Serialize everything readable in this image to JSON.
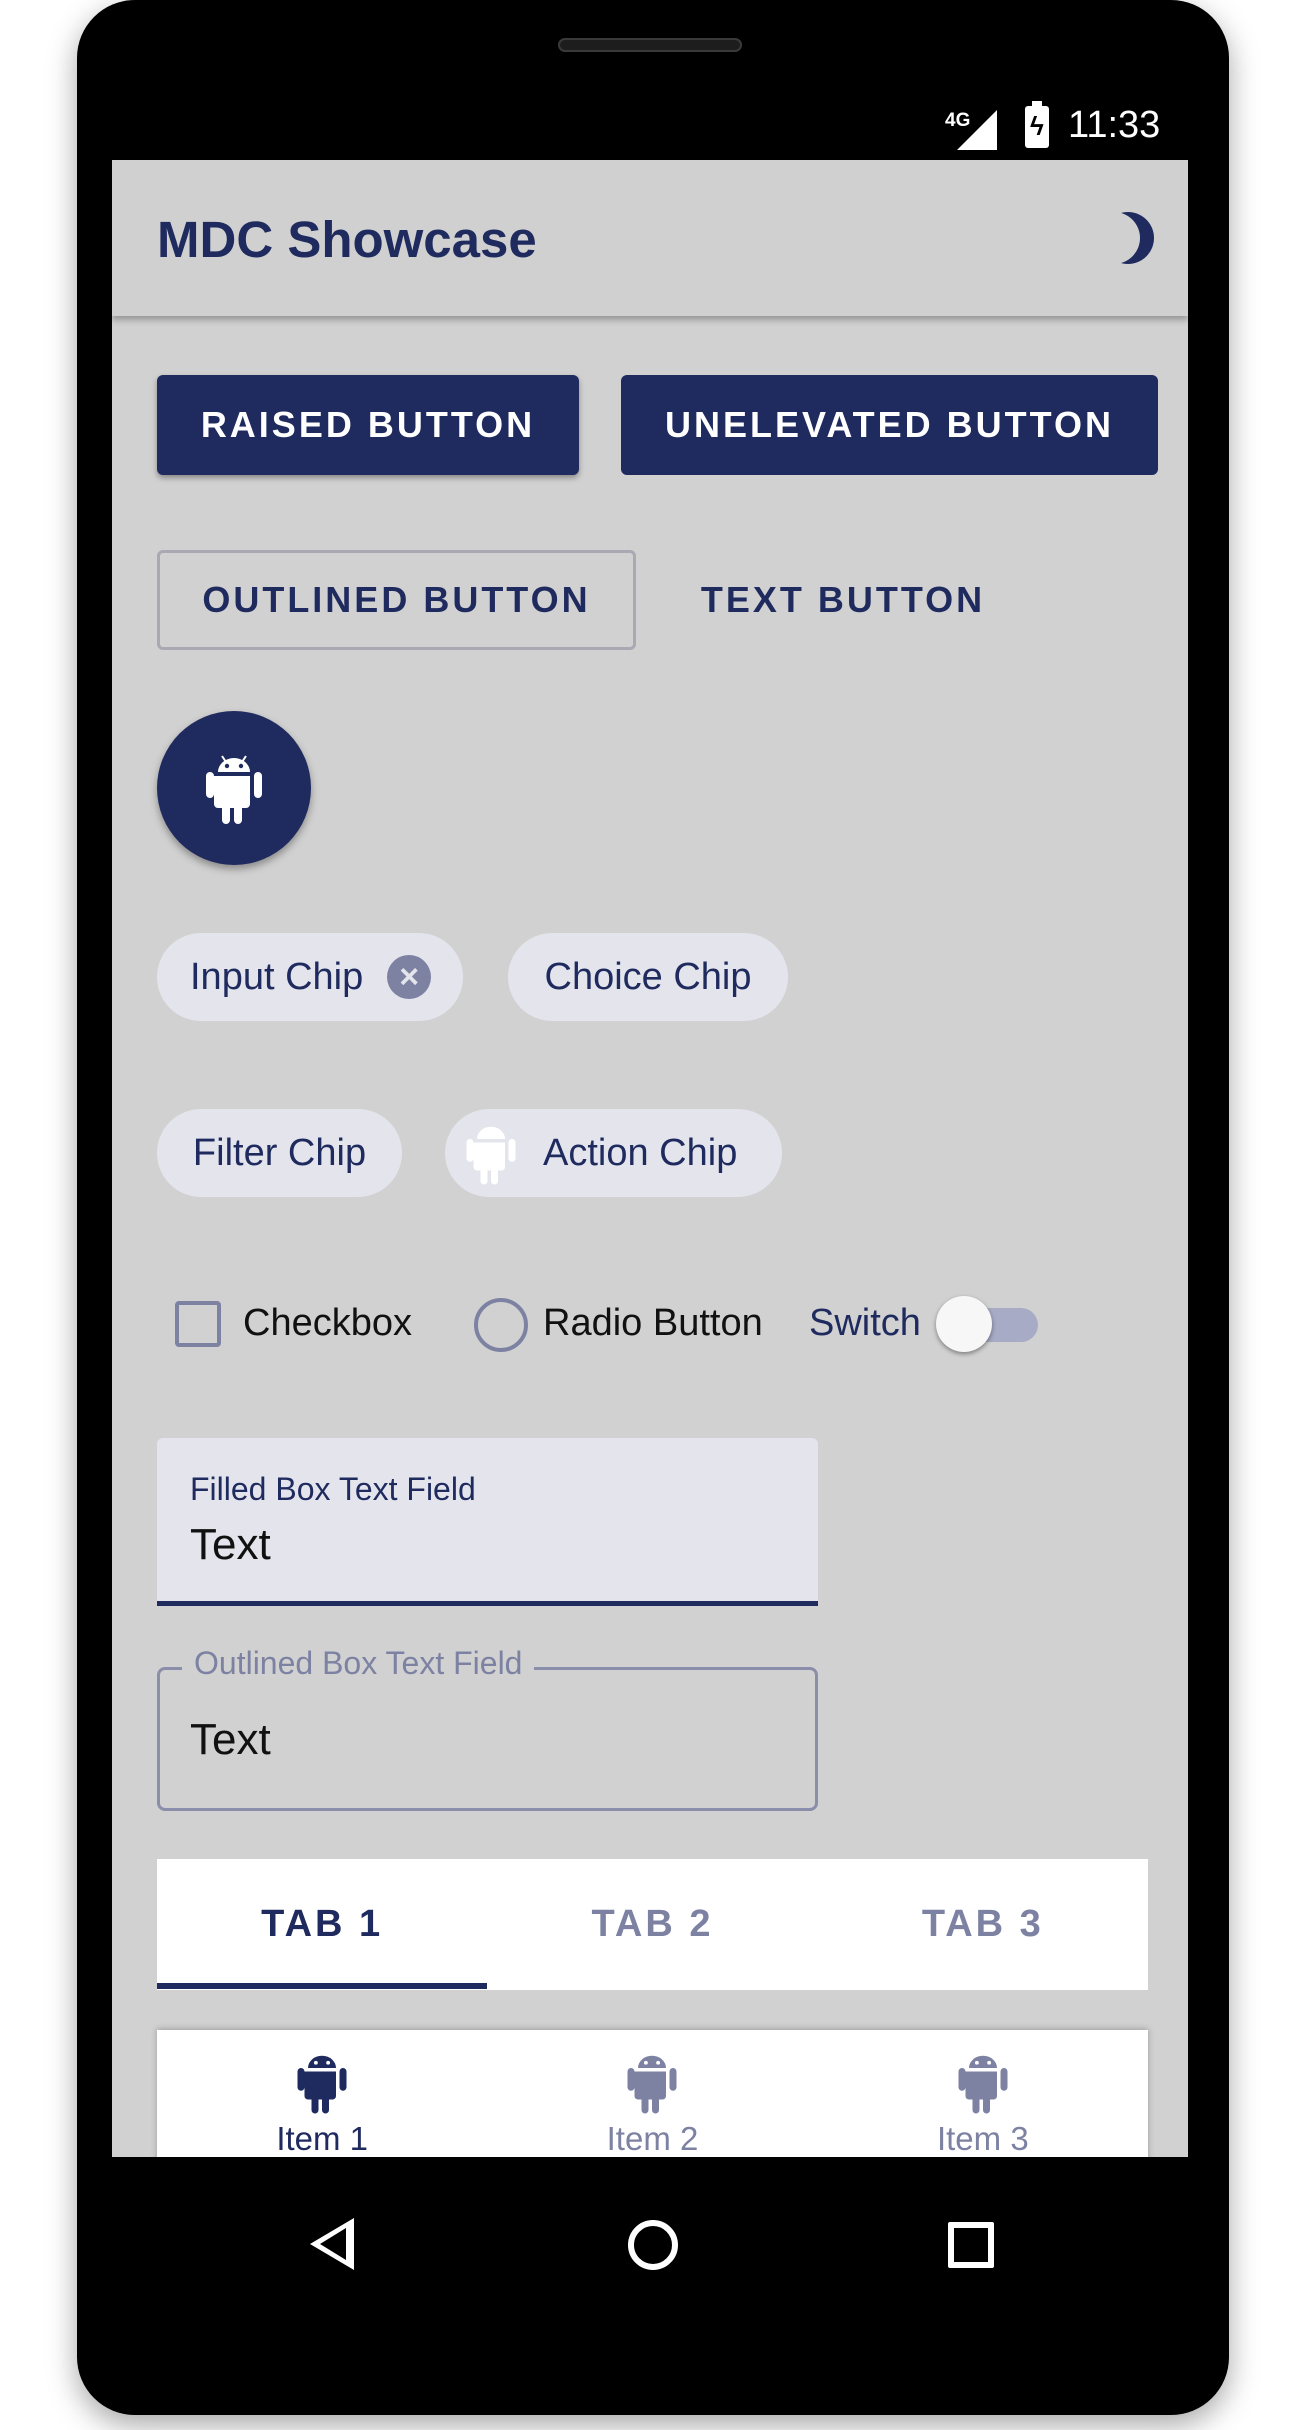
{
  "status_bar": {
    "network": "4G",
    "time": "11:33"
  },
  "app_bar": {
    "title": "MDC Showcase",
    "theme_icon": "moon-icon"
  },
  "buttons": {
    "raised": "RAISED BUTTON",
    "unelevated": "UNELEVATED BUTTON",
    "outlined": "OUTLINED BUTTON",
    "text": "TEXT BUTTON",
    "fab_icon": "android-icon"
  },
  "chips": {
    "input": "Input Chip",
    "choice": "Choice Chip",
    "filter": "Filter Chip",
    "action": "Action Chip"
  },
  "controls": {
    "checkbox": "Checkbox",
    "radio": "Radio Button",
    "switch": "Switch"
  },
  "text_fields": {
    "filled": {
      "label": "Filled Box Text Field",
      "value": "Text"
    },
    "outlined": {
      "label": "Outlined Box Text Field",
      "value": "Text"
    }
  },
  "tabs": [
    {
      "label": "TAB 1",
      "active": true
    },
    {
      "label": "TAB 2",
      "active": false
    },
    {
      "label": "TAB 3",
      "active": false
    }
  ],
  "bottom_nav": [
    {
      "label": "Item 1",
      "active": true
    },
    {
      "label": "Item 2",
      "active": false
    },
    {
      "label": "Item 3",
      "active": false
    }
  ],
  "colors": {
    "primary": "#1f2a5e",
    "surface": "#d1d1d1",
    "chip": "#e4e5ec",
    "inactive": "#7d82a3"
  }
}
